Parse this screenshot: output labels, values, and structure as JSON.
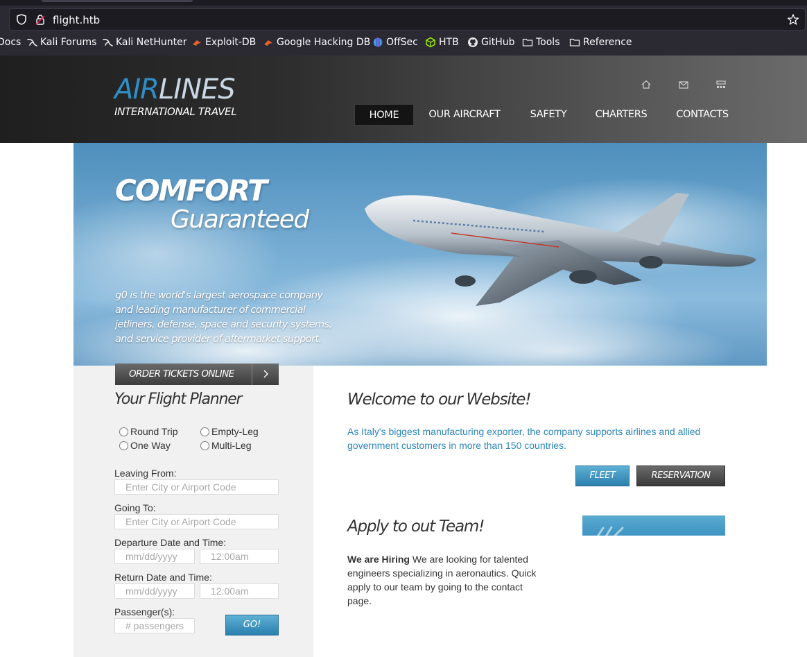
{
  "browser": {
    "url": "flight.htb",
    "bookmarks": [
      {
        "label": "Docs",
        "icon": "none"
      },
      {
        "label": "Kali Forums",
        "icon": "kali-dragon-icon"
      },
      {
        "label": "Kali NetHunter",
        "icon": "kali-dragon-icon"
      },
      {
        "label": "Exploit-DB",
        "icon": "exploit-db-icon"
      },
      {
        "label": "Google Hacking DB",
        "icon": "exploit-db-icon"
      },
      {
        "label": "OffSec",
        "icon": "offsec-icon"
      },
      {
        "label": "HTB",
        "icon": "htb-cube-icon"
      },
      {
        "label": "GitHub",
        "icon": "github-icon"
      },
      {
        "label": "Tools",
        "icon": "folder-icon"
      },
      {
        "label": "Reference",
        "icon": "folder-icon"
      }
    ]
  },
  "site": {
    "logo": {
      "air": "AIR",
      "lines": "LINES",
      "tagline": "INTERNATIONAL TRAVEL"
    },
    "util_icons": [
      "home-icon",
      "mail-icon",
      "sitemap-icon"
    ],
    "nav": [
      {
        "label": "HOME",
        "active": true
      },
      {
        "label": "OUR AIRCRAFT",
        "active": false
      },
      {
        "label": "SAFETY",
        "active": false
      },
      {
        "label": "CHARTERS",
        "active": false
      },
      {
        "label": "CONTACTS",
        "active": false
      }
    ]
  },
  "hero": {
    "title1": "COMFORT",
    "title2": "Guaranteed",
    "description": "g0 is the world's largest aerospace company and leading manufacturer of commercial jetliners, defense, space and security systems, and service provider of aftermarket support."
  },
  "planner": {
    "order_label": "ORDER TICKETS ONLINE",
    "title": "Your Flight Planner",
    "trip_types": [
      {
        "label": "Round Trip"
      },
      {
        "label": "Empty-Leg"
      },
      {
        "label": "One Way"
      },
      {
        "label": "Multi-Leg"
      }
    ],
    "leaving_label": "Leaving From:",
    "leaving_placeholder": "Enter City or Airport Code",
    "going_label": "Going To:",
    "going_placeholder": "Enter City or Airport Code",
    "departure_label": "Departure Date and Time:",
    "return_label": "Return Date and Time:",
    "date_placeholder": "mm/dd/yyyy",
    "time_placeholder": "12:00am",
    "passengers_label": "Passenger(s):",
    "passengers_placeholder": "# passengers",
    "go_label": "GO!"
  },
  "main": {
    "welcome_title": "Welcome to our Website!",
    "welcome_text": "As Italy's biggest manufacturing exporter, the company supports airlines and allied government customers in more than 150 countries.",
    "fleet_label": "FLEET",
    "reservation_label": "RESERVATION",
    "apply_title": "Apply to out Team!",
    "hiring_bold": "We are Hiring",
    "hiring_text": " We are looking for talented engineers specializing in aeronautics. Quick apply to our team by going to the contact page."
  },
  "colors": {
    "accent_blue": "#2e8fc6",
    "link_blue": "#2b86b9",
    "header_dark": "#1f1f1f"
  }
}
